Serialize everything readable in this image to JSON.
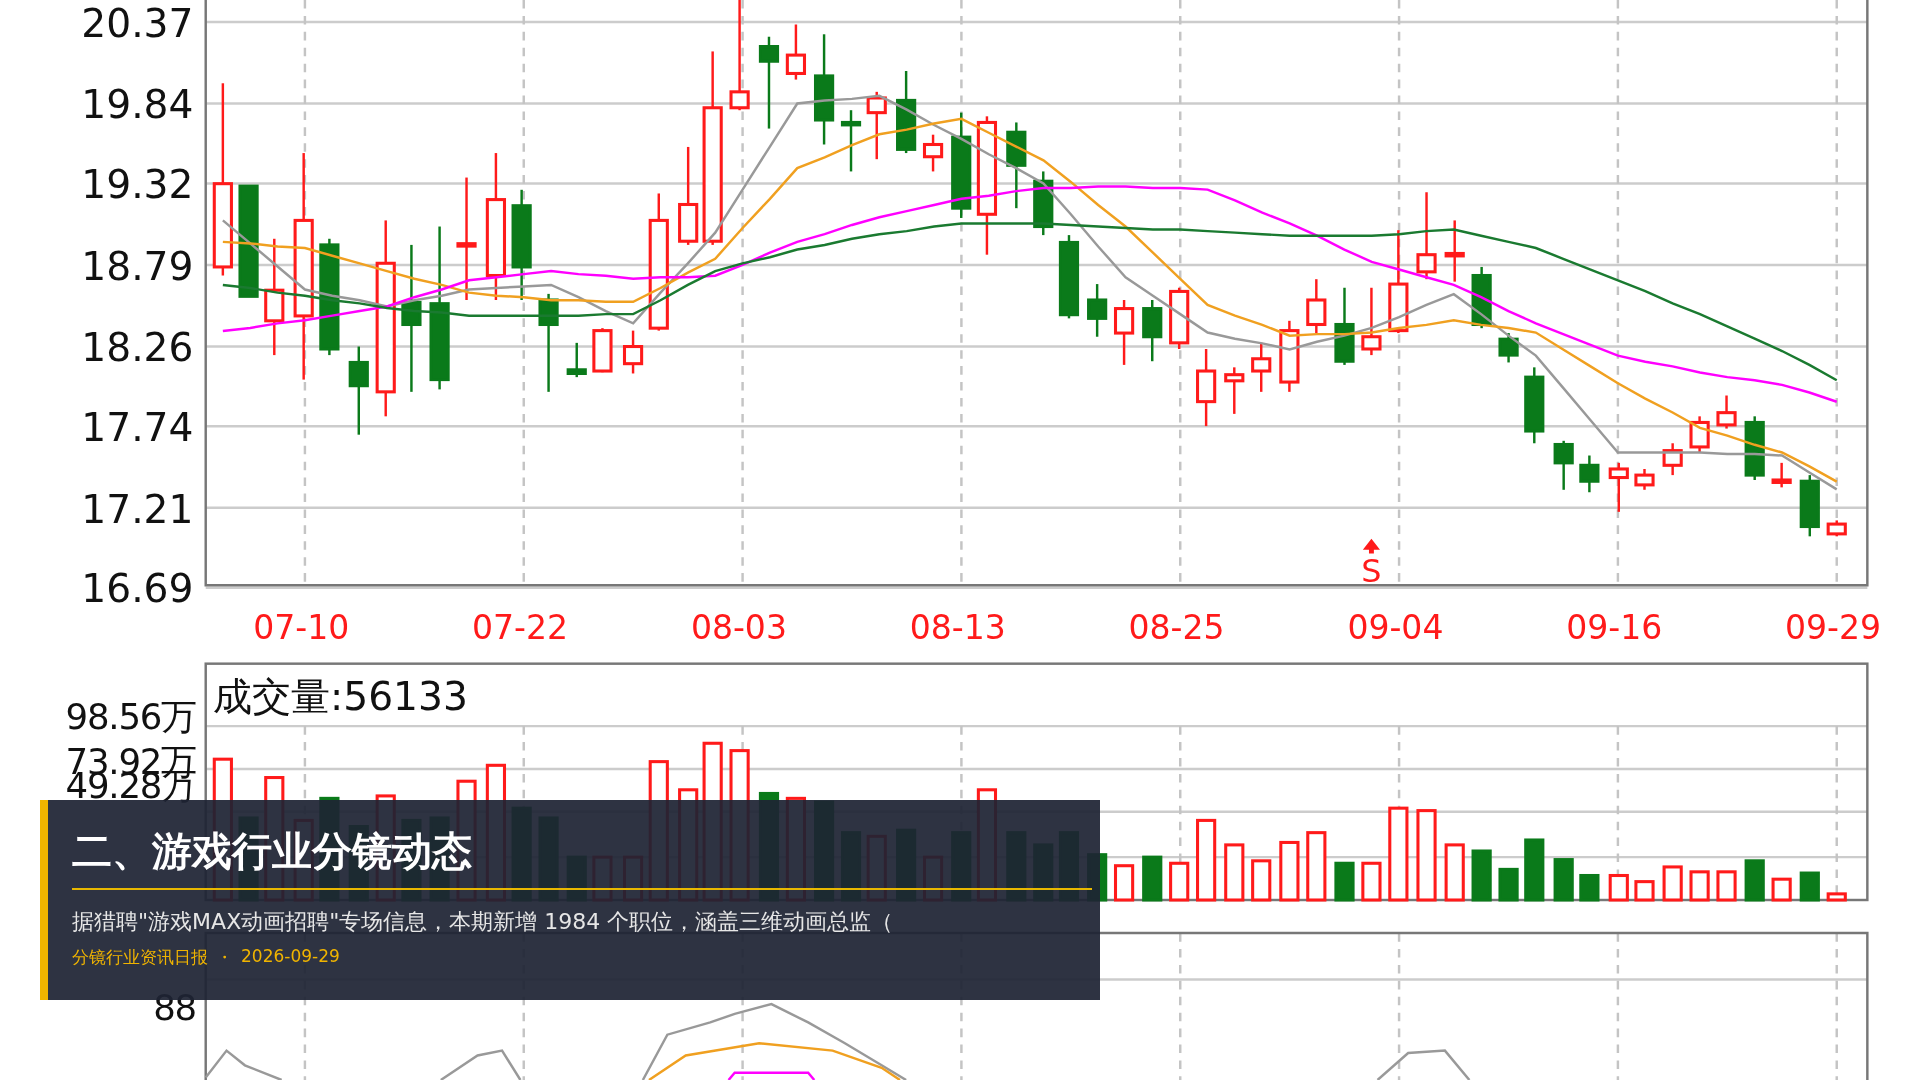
{
  "price_chart": {
    "chart_data": {
      "type": "line",
      "grid": true,
      "ylim": [
        16.69,
        20.37
      ],
      "categories": [
        null,
        null,
        null,
        "07-10",
        null,
        null,
        null,
        null,
        null,
        null,
        null,
        "07-22",
        null,
        null,
        null,
        null,
        null,
        null,
        null,
        "08-03",
        null,
        null,
        null,
        null,
        null,
        null,
        null,
        "08-13",
        null,
        null,
        null,
        null,
        null,
        null,
        null,
        "08-25",
        null,
        null,
        null,
        null,
        null,
        null,
        null,
        "09-04",
        null,
        null,
        null,
        null,
        null,
        null,
        null,
        "09-16",
        null,
        null,
        null,
        null,
        null,
        null,
        null,
        "09-29"
      ],
      "yticks": [
        {
          "value": 20.37,
          "label": "20.37"
        },
        {
          "value": 19.84,
          "label": "19.84"
        },
        {
          "value": 19.32,
          "label": "19.32"
        },
        {
          "value": 18.79,
          "label": "18.79"
        },
        {
          "value": 18.26,
          "label": "18.26"
        },
        {
          "value": 17.74,
          "label": "17.74"
        },
        {
          "value": 17.21,
          "label": "17.21"
        },
        {
          "value": 16.69,
          "label": "16.69"
        }
      ],
      "series": [
        {
          "color": "#999999",
          "values": [
            19.08,
            18.93,
            18.78,
            18.63,
            18.59,
            18.56,
            18.52,
            18.56,
            18.59,
            18.63,
            18.64,
            18.65,
            18.66,
            18.58,
            18.49,
            18.41,
            18.61,
            18.8,
            19.0,
            19.28,
            19.56,
            19.84,
            19.86,
            19.87,
            19.89,
            19.8,
            19.7,
            19.61,
            19.51,
            19.42,
            19.32,
            19.12,
            18.91,
            18.71,
            18.59,
            18.47,
            18.35,
            18.31,
            18.28,
            18.24,
            18.29,
            18.33,
            18.38,
            18.45,
            18.53,
            18.6,
            18.47,
            18.33,
            18.2,
            17.99,
            17.78,
            17.57,
            17.57,
            17.57,
            17.57,
            17.56,
            17.56,
            17.55,
            17.44,
            17.33
          ]
        },
        {
          "color": "#f0a020",
          "values": [
            18.94,
            18.93,
            18.91,
            18.9,
            18.85,
            18.8,
            18.75,
            18.7,
            18.66,
            18.61,
            18.59,
            18.58,
            18.56,
            18.56,
            18.55,
            18.55,
            18.64,
            18.74,
            18.83,
            19.03,
            19.22,
            19.42,
            19.49,
            19.57,
            19.64,
            19.67,
            19.71,
            19.74,
            19.65,
            19.56,
            19.47,
            19.33,
            19.18,
            19.04,
            18.87,
            18.7,
            18.53,
            18.46,
            18.4,
            18.33,
            18.34,
            18.34,
            18.35,
            18.38,
            18.4,
            18.43,
            18.4,
            18.38,
            18.35,
            18.24,
            18.13,
            18.02,
            17.92,
            17.83,
            17.73,
            17.68,
            17.62,
            17.57,
            17.48,
            17.38
          ]
        },
        {
          "color": "#ff00ff",
          "values": [
            18.36,
            18.38,
            18.41,
            18.43,
            18.46,
            18.49,
            18.52,
            18.58,
            18.63,
            18.69,
            18.71,
            18.73,
            18.75,
            18.73,
            18.72,
            18.7,
            18.71,
            18.71,
            18.72,
            18.79,
            18.87,
            18.94,
            18.99,
            19.05,
            19.1,
            19.14,
            19.18,
            19.22,
            19.24,
            19.27,
            19.29,
            19.29,
            19.3,
            19.3,
            19.29,
            19.29,
            19.28,
            19.21,
            19.13,
            19.06,
            18.98,
            18.89,
            18.81,
            18.76,
            18.71,
            18.66,
            18.58,
            18.49,
            18.41,
            18.34,
            18.27,
            18.2,
            18.16,
            18.13,
            18.09,
            18.06,
            18.04,
            18.01,
            17.96,
            17.9
          ]
        },
        {
          "color": "#1a7a30",
          "values": [
            18.66,
            18.64,
            18.61,
            18.59,
            18.56,
            18.54,
            18.51,
            18.49,
            18.48,
            18.46,
            18.46,
            18.46,
            18.46,
            18.46,
            18.47,
            18.47,
            18.56,
            18.66,
            18.75,
            18.8,
            18.84,
            18.89,
            18.92,
            18.96,
            18.99,
            19.01,
            19.04,
            19.06,
            19.06,
            19.06,
            19.06,
            19.05,
            19.04,
            19.03,
            19.02,
            19.02,
            19.01,
            19.0,
            18.99,
            18.98,
            18.98,
            18.98,
            18.98,
            18.99,
            19.01,
            19.02,
            18.98,
            18.94,
            18.9,
            18.83,
            18.76,
            18.69,
            18.62,
            18.54,
            18.47,
            18.39,
            18.31,
            18.23,
            18.14,
            18.04
          ]
        }
      ]
    },
    "signal_marker": "S"
  },
  "volume_chart": {
    "title": "成交量:56133",
    "y_labels": [
      "98.56万",
      "73.92万",
      "49.28万"
    ]
  },
  "rsi_chart": {
    "y_labels": [
      "88"
    ]
  },
  "news_card": {
    "title": "二、游戏行业分镜动态",
    "summary": "据猎聘\"游戏MAX动画招聘\"专场信息，本期新增 1984 个职位，涵盖三维动画总监（",
    "source": "分镜行业资讯日报",
    "separator": "・",
    "date": "2026-09-29"
  }
}
